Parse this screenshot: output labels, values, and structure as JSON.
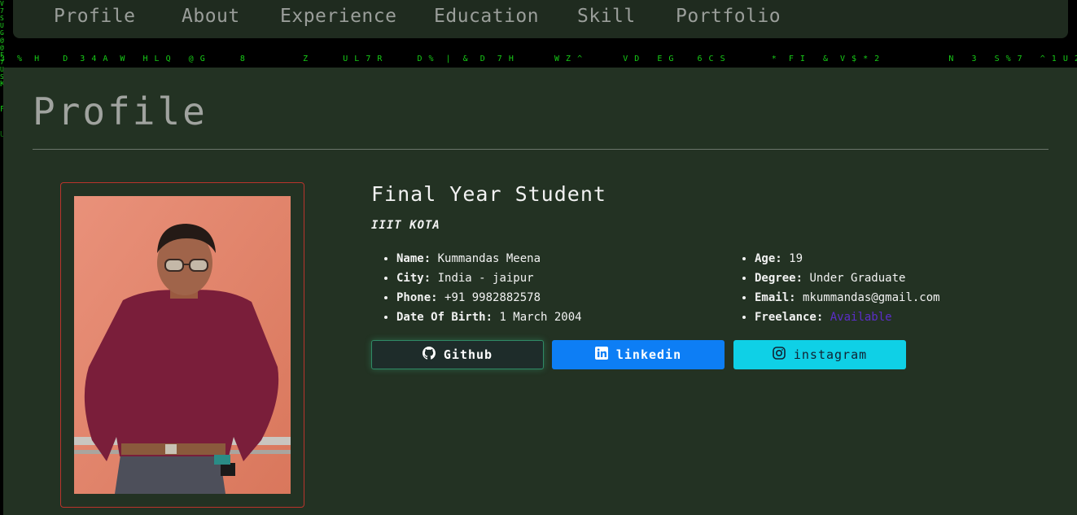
{
  "nav": {
    "items": [
      {
        "label": "Profile"
      },
      {
        "label": "About"
      },
      {
        "label": "Experience"
      },
      {
        "label": "Education"
      },
      {
        "label": "Skill"
      },
      {
        "label": "Portfolio"
      }
    ]
  },
  "profile": {
    "page_title": "Profile",
    "role": "Final Year Student",
    "org": "IIIT KOTA",
    "left_details": [
      {
        "key": "Name:",
        "value": "Kummandas Meena"
      },
      {
        "key": "City:",
        "value": "India - jaipur"
      },
      {
        "key": "Phone:",
        "value": "+91 9982882578"
      },
      {
        "key": "Date Of Birth:",
        "value": "1 March 2004"
      }
    ],
    "right_details": [
      {
        "key": "Age:",
        "value": "19"
      },
      {
        "key": "Degree:",
        "value": "Under Graduate"
      },
      {
        "key": "Email:",
        "value": "mkummandas@gmail.com"
      },
      {
        "key": "Freelance:",
        "value": "Available"
      }
    ]
  },
  "social": {
    "github": {
      "label": "Github",
      "icon": "github-icon"
    },
    "linkedin": {
      "label": "linkedin",
      "icon": "linkedin-icon"
    },
    "instagram": {
      "label": "instagram",
      "icon": "instagram-icon"
    }
  },
  "colors": {
    "panel": "#233223",
    "nav": "#1f2b1f",
    "matrix_green": "#19d619",
    "linkedin_blue": "#0d7ef5",
    "instagram_cyan": "#0fd0e6",
    "available": "#5b2dc9",
    "photo_border": "#b9342c"
  }
}
